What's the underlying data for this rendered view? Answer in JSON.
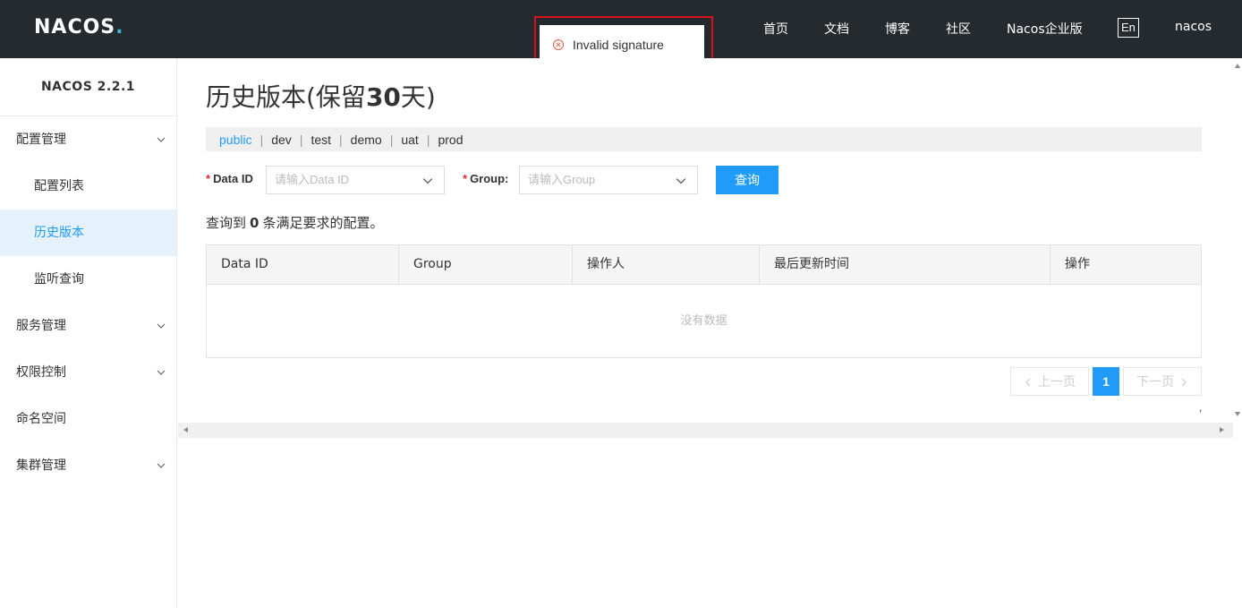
{
  "header": {
    "logo": {
      "n": "NA",
      "o": "C",
      "rest": "OS",
      "dot": "."
    },
    "nav": [
      "首页",
      "文档",
      "博客",
      "社区",
      "Nacos企业版"
    ],
    "lang": "En",
    "user": "nacos"
  },
  "toast": {
    "message": "Invalid signature",
    "icon": "error-circle-icon"
  },
  "sidebar": {
    "version": "NACOS 2.2.1",
    "items": [
      {
        "label": "配置管理",
        "type": "group",
        "expandable": true
      },
      {
        "label": "配置列表",
        "type": "sub"
      },
      {
        "label": "历史版本",
        "type": "sub",
        "active": true
      },
      {
        "label": "监听查询",
        "type": "sub"
      },
      {
        "label": "服务管理",
        "type": "group",
        "expandable": true
      },
      {
        "label": "权限控制",
        "type": "group",
        "expandable": true
      },
      {
        "label": "命名空间",
        "type": "group"
      },
      {
        "label": "集群管理",
        "type": "group",
        "expandable": true
      }
    ]
  },
  "main": {
    "title_prefix": "历史版本(保留",
    "title_days": "30",
    "title_suffix": "天)",
    "namespaces": [
      "public",
      "dev",
      "test",
      "demo",
      "uat",
      "prod"
    ],
    "active_namespace": "public",
    "form": {
      "required_mark": "*",
      "data_id_label": "Data ID",
      "data_id_placeholder": "请输入Data ID",
      "group_label": "Group:",
      "group_placeholder": "请输入Group",
      "query_button": "查询"
    },
    "result": {
      "prefix": "查询到",
      "count": "0",
      "suffix": "条满足要求的配置。"
    },
    "table": {
      "columns": [
        "Data ID",
        "Group",
        "操作人",
        "最后更新时间",
        "操作"
      ],
      "empty_text": "没有数据"
    },
    "pagination": {
      "prev": "上一页",
      "current": "1",
      "next": "下一页"
    },
    "stray_mark": ","
  },
  "colors": {
    "header_bg": "#252a2f",
    "accent": "#209bfa",
    "error": "#d9111e",
    "active_bg": "#e5f2fb"
  }
}
